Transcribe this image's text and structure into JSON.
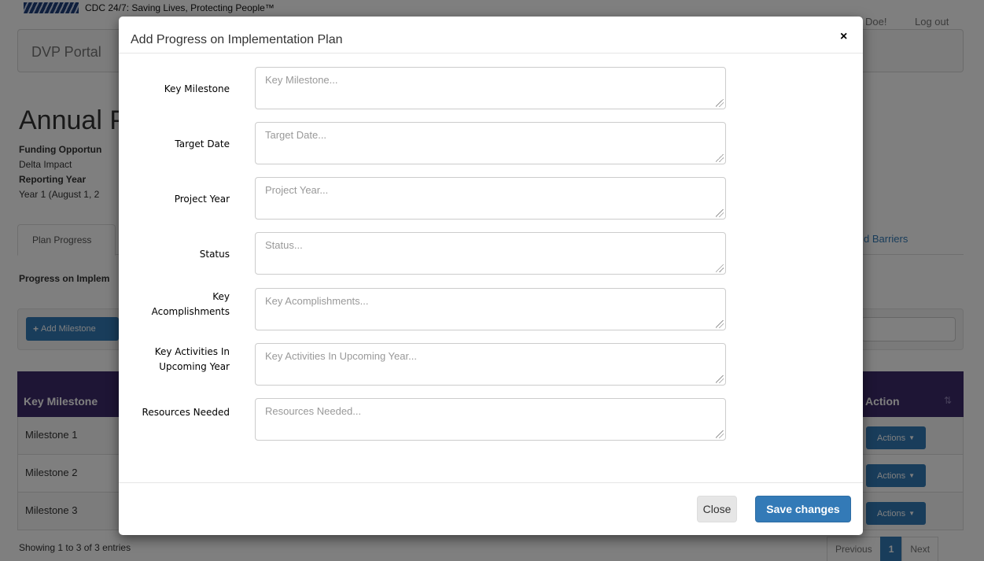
{
  "header": {
    "cdc_tagline": "CDC 24/7: Saving Lives, Protecting People™",
    "brand": "DVP Portal",
    "user_greeting": "Doe!",
    "logout": "Log out"
  },
  "page": {
    "title": "Annual P",
    "funding_label": "Funding Opportun",
    "funding_value": "Delta Impact",
    "reporting_label": "Reporting Year",
    "reporting_value": "Year 1 (August 1, 2",
    "tab_active": "Plan Progress",
    "tab_right": "d Barriers",
    "section_heading": "Progress on Implem",
    "add_button": "Add Milestone"
  },
  "table": {
    "header_left": "Key Milestone",
    "header_action": "Action",
    "rows": [
      {
        "label": "Milestone 1",
        "action": "Actions"
      },
      {
        "label": "Milestone 2",
        "action": "Actions"
      },
      {
        "label": "Milestone 3",
        "action": "Actions"
      }
    ],
    "showing": "Showing 1 to 3 of 3 entries",
    "pagination": {
      "previous": "Previous",
      "current": "1",
      "next": "Next"
    }
  },
  "modal": {
    "title": "Add Progress on Implementation Plan",
    "close_symbol": "×",
    "fields": [
      {
        "label": "Key Milestone",
        "placeholder": "Key Milestone...",
        "value": ""
      },
      {
        "label": "Target Date",
        "placeholder": "Target Date...",
        "value": ""
      },
      {
        "label": "Project Year",
        "placeholder": "Project Year...",
        "value": ""
      },
      {
        "label": "Status",
        "placeholder": "Status...",
        "value": ""
      },
      {
        "label_line1": "Key",
        "label_line2": "Acomplishments",
        "placeholder": "Key Acomplishments...",
        "value": ""
      },
      {
        "label_line1": "Key Activities In",
        "label_line2": "Upcoming Year",
        "placeholder": "Key Activities In Upcoming Year...",
        "value": ""
      },
      {
        "label": "Resources Needed",
        "placeholder": "Resources Needed...",
        "value": ""
      }
    ],
    "close_button": "Close",
    "save_button": "Save changes"
  }
}
